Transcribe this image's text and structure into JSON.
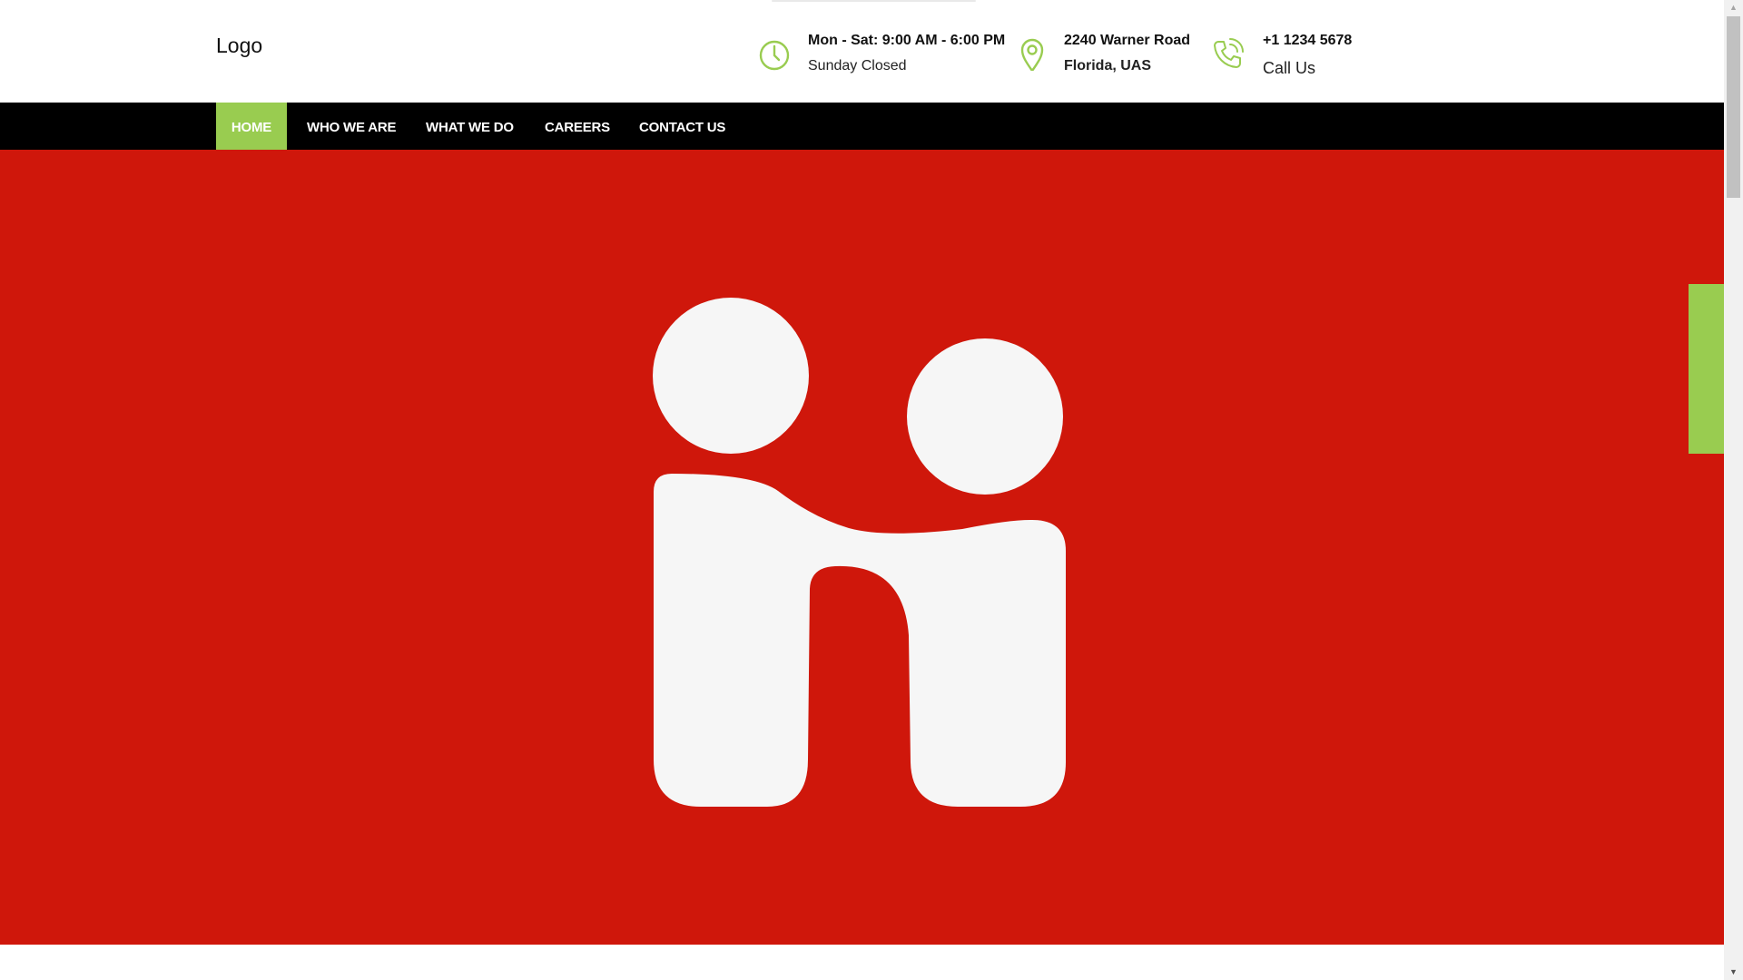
{
  "header": {
    "logo_text": "Logo",
    "hours": {
      "line1": "Mon - Sat: 9:00 AM - 6:00 PM",
      "line2": "Sunday Closed",
      "icon": "clock-icon"
    },
    "address": {
      "line1": "2240 Warner Road",
      "line2": "Florida, UAS",
      "icon": "map-pin-icon"
    },
    "phone": {
      "line1": "+1 1234 5678",
      "line2": "Call Us",
      "icon": "phone-icon"
    }
  },
  "nav": {
    "items": [
      {
        "label": "HOME",
        "active": true
      },
      {
        "label": "WHO WE ARE",
        "active": false
      },
      {
        "label": "WHAT WE DO",
        "active": false
      },
      {
        "label": "CAREERS",
        "active": false
      },
      {
        "label": "CONTACT US",
        "active": false
      }
    ]
  },
  "hero": {
    "image": "handshake-logo"
  },
  "colors": {
    "accent": "#99cc50",
    "nav_bg": "#000000",
    "hero_bg": "#cf170b",
    "logo_white": "#f6f6f6"
  },
  "scrollbar": {
    "up_glyph": "▲",
    "down_glyph": "▼"
  }
}
